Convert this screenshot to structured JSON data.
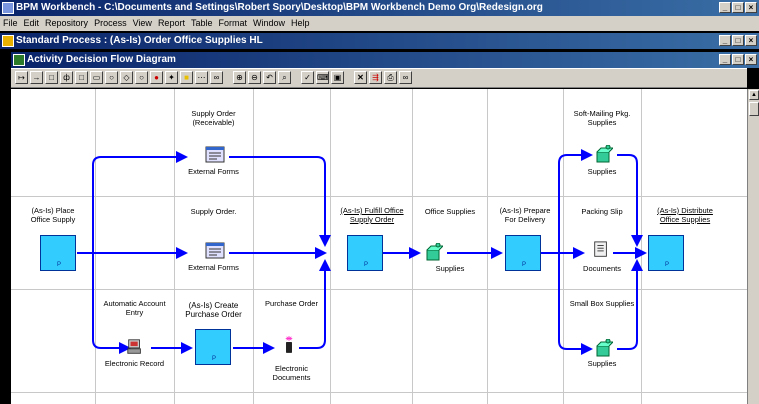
{
  "app_window": {
    "title": "BPM Workbench - C:\\Documents and Settings\\Robert Spory\\Desktop\\BPM Workbench Demo Org\\Redesign.org"
  },
  "menu": [
    "File",
    "Edit",
    "Repository",
    "Process",
    "View",
    "Report",
    "Table",
    "Format",
    "Window",
    "Help"
  ],
  "process_window": {
    "title": "Standard Process : (As-Is) Order Office Supplies HL"
  },
  "diagram_window": {
    "title": "Activity Decision Flow Diagram"
  },
  "toolbar_icons": [
    "connector-icon",
    "arrow-icon",
    "rectangle-icon",
    "decision-icon",
    "square-icon",
    "rounded-rect-icon",
    "oval-icon",
    "diamond-icon",
    "circle-icon",
    "stop-icon",
    "gear-icon",
    "yellow-box-icon",
    "dotted-box-icon",
    "link-icon",
    "zoom-in-icon",
    "zoom-out-icon",
    "undo-icon",
    "search-icon",
    "check-icon",
    "keyboard-icon",
    "window-icon",
    "close-x-icon",
    "flow-icon",
    "print-icon",
    "binoculars-icon"
  ],
  "diagram": {
    "activities": {
      "place": "(As-Is) Place\nOffice Supply",
      "fulfill": "(As-Is) Fulfill Office\nSupply Order",
      "prepare": "(As-Is) Prepare\nFor Delivery",
      "distribute": "(As-Is) Distribute\nOffice Supplies",
      "create_po": "(As-Is) Create\nPurchase Order"
    },
    "labels": {
      "supply_order_receivable": "Supply Order\n(Receivable)",
      "external_forms_1": "External Forms",
      "supply_order": "Supply Order.",
      "external_forms_2": "External Forms",
      "office_supplies": "Office Supplies",
      "supplies_mid": "Supplies",
      "soft_mailing": "Soft-Mailing Pkg.\nSupplies",
      "supplies_top": "Supplies",
      "packing_slip": "Packing Slip",
      "documents": "Documents",
      "small_box": "Small Box Supplies",
      "supplies_bottom": "Supplies",
      "automatic_account": "Automatic Account\nEntry",
      "electronic_record": "Electronic Record",
      "purchase_order": "Purchase Order",
      "electronic_documents": "Electronic\nDocuments"
    }
  },
  "colors": {
    "titlebar": "#0a246a",
    "activity_fill": "#33ccff",
    "flow_line": "#0000ff",
    "chrome": "#d4d0c8"
  }
}
